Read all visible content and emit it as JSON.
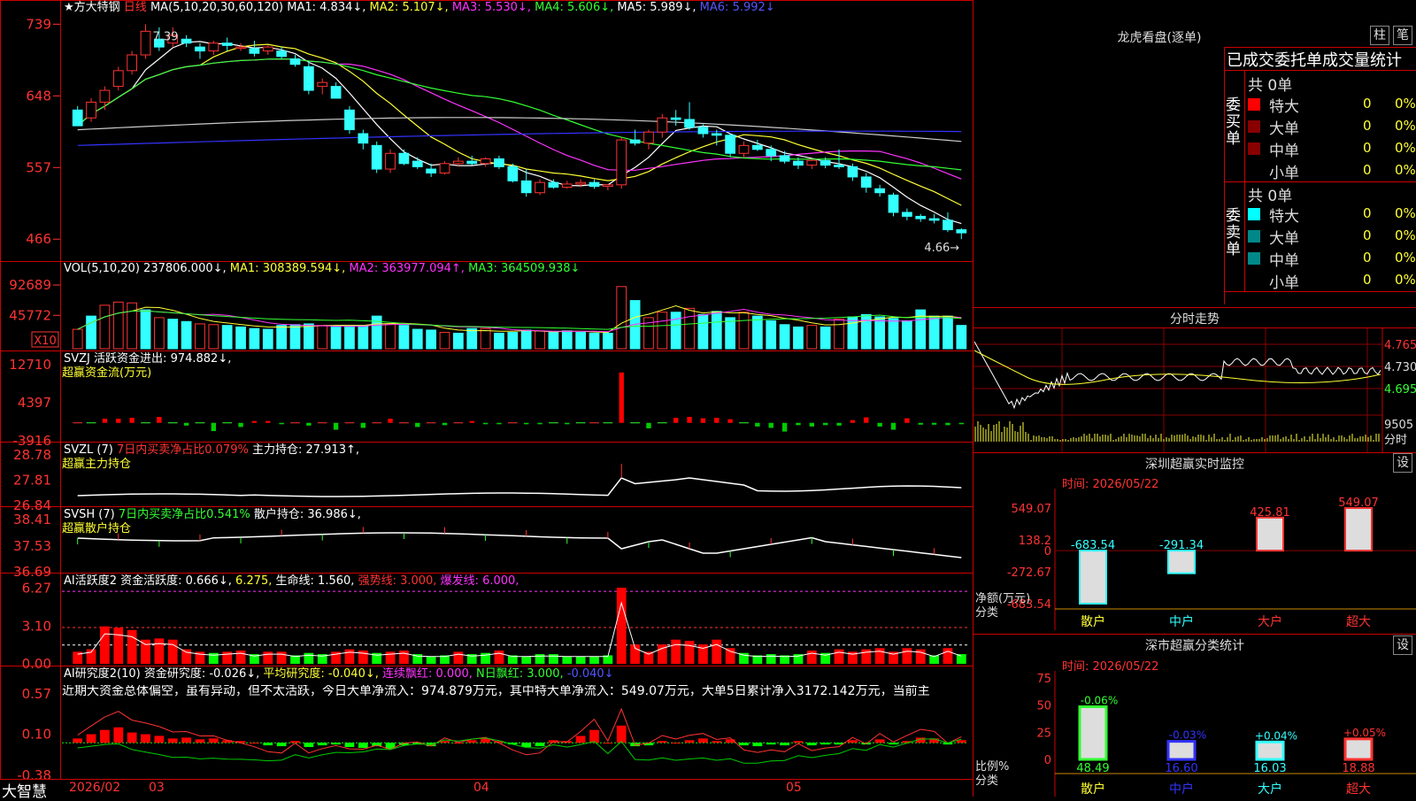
{
  "stock": {
    "title": "★方大特钢",
    "period": "日线"
  },
  "kline": {
    "header": {
      "ma_label": "MA(5,10,20,30,60,120)",
      "ma1": "MA1: 4.834↓,",
      "ma2": "MA2: 5.107↓,",
      "ma3": "MA3: 5.530↓,",
      "ma4": "MA4: 5.606↓,",
      "ma5": "MA5: 5.989↓,",
      "ma6": "MA6: 5.992↓"
    },
    "high_label": "7.39",
    "low_label": "4.66",
    "ylabels": [
      "739",
      "648",
      "557",
      "466"
    ],
    "ohlc": [
      [
        6.3,
        6.35,
        6.1,
        6.1
      ],
      [
        6.2,
        6.45,
        6.15,
        6.4
      ],
      [
        6.4,
        6.6,
        6.3,
        6.55
      ],
      [
        6.6,
        6.85,
        6.55,
        6.8
      ],
      [
        6.8,
        7.05,
        6.75,
        7.0
      ],
      [
        7.0,
        7.39,
        6.95,
        7.3
      ],
      [
        7.2,
        7.35,
        7.05,
        7.1
      ],
      [
        7.15,
        7.35,
        7.1,
        7.25
      ],
      [
        7.2,
        7.25,
        7.1,
        7.15
      ],
      [
        7.1,
        7.15,
        6.95,
        7.05
      ],
      [
        7.05,
        7.18,
        7.0,
        7.15
      ],
      [
        7.15,
        7.22,
        7.05,
        7.12
      ],
      [
        7.1,
        7.15,
        7.05,
        7.1
      ],
      [
        7.08,
        7.18,
        6.98,
        7.02
      ],
      [
        7.05,
        7.12,
        7.0,
        7.1
      ],
      [
        7.05,
        7.1,
        6.95,
        6.98
      ],
      [
        6.95,
        7.0,
        6.85,
        6.88
      ],
      [
        6.85,
        6.92,
        6.5,
        6.55
      ],
      [
        6.6,
        6.7,
        6.5,
        6.65
      ],
      [
        6.6,
        6.65,
        6.45,
        6.45
      ],
      [
        6.3,
        6.35,
        6.0,
        6.05
      ],
      [
        6.0,
        6.05,
        5.8,
        5.88
      ],
      [
        5.85,
        5.9,
        5.5,
        5.55
      ],
      [
        5.55,
        5.8,
        5.5,
        5.75
      ],
      [
        5.75,
        5.8,
        5.6,
        5.62
      ],
      [
        5.65,
        5.7,
        5.55,
        5.58
      ],
      [
        5.55,
        5.62,
        5.45,
        5.5
      ],
      [
        5.5,
        5.65,
        5.48,
        5.62
      ],
      [
        5.62,
        5.7,
        5.58,
        5.65
      ],
      [
        5.65,
        5.72,
        5.6,
        5.62
      ],
      [
        5.62,
        5.7,
        5.58,
        5.68
      ],
      [
        5.68,
        5.72,
        5.55,
        5.58
      ],
      [
        5.58,
        5.62,
        5.38,
        5.4
      ],
      [
        5.4,
        5.55,
        5.2,
        5.25
      ],
      [
        5.25,
        5.42,
        5.22,
        5.38
      ],
      [
        5.38,
        5.42,
        5.3,
        5.32
      ],
      [
        5.32,
        5.4,
        5.3,
        5.36
      ],
      [
        5.36,
        5.42,
        5.32,
        5.38
      ],
      [
        5.38,
        5.42,
        5.3,
        5.33
      ],
      [
        5.33,
        5.36,
        5.28,
        5.35
      ],
      [
        5.35,
        5.95,
        5.3,
        5.92
      ],
      [
        5.92,
        6.05,
        5.85,
        5.88
      ],
      [
        5.88,
        6.05,
        5.8,
        6.02
      ],
      [
        6.02,
        6.25,
        5.95,
        6.2
      ],
      [
        6.2,
        6.3,
        6.1,
        6.18
      ],
      [
        6.18,
        6.4,
        6.05,
        6.08
      ],
      [
        6.08,
        6.12,
        5.95,
        6.0
      ],
      [
        6.0,
        6.05,
        5.85,
        5.98
      ],
      [
        5.98,
        6.0,
        5.7,
        5.75
      ],
      [
        5.75,
        5.9,
        5.7,
        5.85
      ],
      [
        5.85,
        5.92,
        5.78,
        5.8
      ],
      [
        5.8,
        5.85,
        5.65,
        5.72
      ],
      [
        5.72,
        5.78,
        5.62,
        5.65
      ],
      [
        5.65,
        5.7,
        5.55,
        5.6
      ],
      [
        5.6,
        5.68,
        5.55,
        5.66
      ],
      [
        5.66,
        5.7,
        5.56,
        5.6
      ],
      [
        5.6,
        5.8,
        5.55,
        5.58
      ],
      [
        5.58,
        5.62,
        5.4,
        5.45
      ],
      [
        5.45,
        5.5,
        5.25,
        5.32
      ],
      [
        5.3,
        5.35,
        5.2,
        5.25
      ],
      [
        5.22,
        5.25,
        4.95,
        5.0
      ],
      [
        5.0,
        5.05,
        4.9,
        4.95
      ],
      [
        4.95,
        4.98,
        4.88,
        4.92
      ],
      [
        4.92,
        4.98,
        4.86,
        4.9
      ],
      [
        4.9,
        5.0,
        4.75,
        4.78
      ],
      [
        4.78,
        4.8,
        4.66,
        4.74
      ]
    ],
    "ma_colors": [
      "#fff",
      "#ff3",
      "#f3f",
      "#3f3",
      "#ccc",
      "#33f"
    ],
    "month_labels": [
      "2026/02",
      "03",
      "04",
      "05"
    ]
  },
  "vol": {
    "header": {
      "name": "VOL(5,10,20)",
      "v": "237806.000↓,",
      "ma1": "MA1: 308389.594↓,",
      "ma2": "MA2: 363977.094↑,",
      "ma3": "MA3: 364509.938↓"
    },
    "ylabels": [
      "92689",
      "45772",
      "X10"
    ],
    "values": [
      250,
      420,
      560,
      600,
      590,
      500,
      400,
      380,
      350,
      320,
      310,
      300,
      280,
      260,
      250,
      300,
      310,
      320,
      300,
      280,
      300,
      300,
      420,
      320,
      300,
      250,
      240,
      210,
      200,
      260,
      260,
      200,
      210,
      240,
      230,
      210,
      230,
      210,
      200,
      200,
      800,
      620,
      400,
      470,
      470,
      520,
      440,
      480,
      400,
      470,
      420,
      360,
      310,
      280,
      300,
      280,
      380,
      410,
      440,
      410,
      390,
      360,
      500,
      420,
      420,
      300,
      420,
      380,
      200
    ],
    "up": [
      true,
      false,
      true,
      true,
      true,
      false,
      true,
      false,
      false,
      true,
      true,
      false,
      false,
      false,
      false,
      false,
      false,
      false,
      true,
      false,
      false,
      false,
      false,
      true,
      false,
      false,
      false,
      true,
      false,
      false,
      true,
      false,
      false,
      false,
      true,
      false,
      false,
      false,
      false,
      false,
      true,
      false,
      true,
      true,
      false,
      true,
      false,
      false,
      false,
      true,
      false,
      false,
      false,
      false,
      true,
      false,
      true,
      false,
      false,
      false,
      false,
      false,
      false,
      false,
      false,
      false,
      false,
      false,
      false
    ]
  },
  "svzj": {
    "header": {
      "name": "SVZJ",
      "desc": "活跃资金进出:",
      "val": "974.882↓,",
      "sub": "超赢资金流(万元)"
    },
    "ylabels": [
      "12710",
      "4397",
      "-3916"
    ],
    "values": [
      0,
      0,
      900,
      900,
      1100,
      0,
      1300,
      0,
      -600,
      0,
      -1800,
      0,
      -900,
      400,
      400,
      -300,
      0,
      -600,
      0,
      -1500,
      0,
      -1100,
      0,
      900,
      0,
      -900,
      0,
      -500,
      0,
      400,
      -300,
      -300,
      0,
      -300,
      -300,
      0,
      -300,
      0,
      0,
      0,
      11000,
      0,
      -1200,
      0,
      1100,
      1300,
      1000,
      1100,
      800,
      0,
      -800,
      -1100,
      -1900,
      -500,
      -800,
      -500,
      -600,
      600,
      1200,
      -800,
      -1500,
      1000,
      -400,
      -400,
      -500,
      -300,
      1000,
      900,
      800
    ]
  },
  "svzl": {
    "header": {
      "name": "SVZL (7)",
      "desc": "7日内买卖净占比0.079%",
      "val": "主力持仓: 27.913↑,",
      "sub": "超赢主力持仓"
    },
    "ylabels": [
      "28.78",
      "27.81",
      "26.84"
    ]
  },
  "svsh": {
    "header": {
      "name": "SVSH (7)",
      "desc": "7日内买卖净占比0.541%",
      "val": "散户持仓: 36.986↓,",
      "sub": "超赢散户持仓"
    },
    "ylabels": [
      "38.41",
      "37.53",
      "36.69"
    ]
  },
  "ai": {
    "header": {
      "name": "AI活跃度2",
      "t1": "资金活跃度: 0.666↓,",
      "t2": "6.275,",
      "t3": "生命线: 1.560,",
      "t4": "强势线: 3.000,",
      "t5": "爆发线: 6.000,"
    },
    "ylabels": [
      "6.27",
      "3.10",
      "0.00"
    ],
    "values": [
      1.0,
      1.2,
      3.1,
      3.0,
      2.8,
      2.0,
      2.1,
      2.0,
      1.2,
      1.0,
      0.9,
      1.0,
      1.1,
      0.8,
      1.0,
      1.0,
      0.7,
      0.9,
      0.8,
      1.0,
      1.2,
      1.1,
      0.9,
      1.0,
      1.1,
      0.8,
      0.6,
      0.7,
      1.0,
      0.8,
      0.9,
      1.1,
      0.7,
      0.6,
      0.8,
      0.8,
      0.6,
      0.6,
      0.6,
      0.7,
      6.3,
      1.6,
      1.0,
      1.6,
      2.0,
      1.9,
      1.6,
      2.0,
      1.3,
      0.9,
      0.7,
      0.8,
      0.7,
      0.8,
      1.1,
      0.9,
      1.2,
      1.0,
      1.2,
      1.3,
      1.0,
      1.3,
      1.2,
      0.7,
      1.3,
      0.8,
      1.2,
      1.2,
      0.8
    ]
  },
  "research": {
    "header": {
      "name": "AI研究度2(10)",
      "t1": "资金研究度: -0.026↓,",
      "t2": "平均研究度: -0.040↓,",
      "t3": "连续飘红: 0.000,",
      "t4": "N日飘红: 3.000,",
      "t5": "-0.040↓"
    },
    "comment": "近期大资金总体偏空，虽有异动，但不太活跃，今日大单净流入：974.879万元，其中特大单净流入：549.07万元，大单5日累计净入3172.142万元，当前主",
    "ylabels": [
      "0.57",
      "0.10",
      "-0.38"
    ],
    "values": [
      0.05,
      0.1,
      0.15,
      0.18,
      0.12,
      0.1,
      0.08,
      0.05,
      0.06,
      0.04,
      0.05,
      0.03,
      0.02,
      0.0,
      -0.03,
      -0.04,
      0.02,
      -0.05,
      -0.03,
      -0.02,
      -0.05,
      -0.06,
      -0.04,
      -0.07,
      -0.03,
      -0.02,
      -0.04,
      0.02,
      0.0,
      0.03,
      0.05,
      0.02,
      -0.02,
      -0.05,
      -0.04,
      0.03,
      0.02,
      0.08,
      0.15,
      0.0,
      0.2,
      -0.04,
      -0.03,
      0.02,
      0.0,
      0.03,
      0.05,
      0.02,
      0.04,
      -0.03,
      -0.04,
      -0.02,
      -0.03,
      0.02,
      -0.03,
      -0.02,
      -0.02,
      0.03,
      -0.02,
      0.04,
      -0.02,
      0.02,
      0.06,
      0.05,
      -0.02,
      0.03,
      -0.03,
      0.02,
      -0.02
    ]
  },
  "footer": {
    "brand": "大智慧"
  },
  "dragon": {
    "title": "龙虎看盘(逐单)",
    "btn1": "柱",
    "btn2": "笔",
    "subtitle": "已成交委托单成交量统计",
    "buy_label": "委买单",
    "sell_label": "委卖单",
    "buy_total": "共 0单",
    "sell_total": "共 0单",
    "rows": [
      "特大",
      "大单",
      "中单",
      "小单"
    ],
    "count": "0",
    "pct": "0%",
    "buy_colors": [
      "#f00",
      "#800",
      "#800",
      ""
    ],
    "sell_colors": [
      "#0ff",
      "#088",
      "#088",
      ""
    ]
  },
  "minute": {
    "title": "分时走势",
    "ylabels": [
      "4.765",
      "4.730",
      "4.695",
      "9505",
      "分时"
    ]
  },
  "sz_monitor": {
    "title": "深圳超赢实时监控",
    "btn": "设",
    "time": "时间: 2026/05/22",
    "ylabels": [
      "549.07",
      "138.2",
      "0",
      "-272.67",
      "-683.54"
    ],
    "unit": "净额(万元)",
    "cat_label": "分类",
    "chart_data": {
      "type": "bar",
      "categories": [
        "散户",
        "中户",
        "大户",
        "超大"
      ],
      "values": [
        -683.54,
        -291.34,
        425.81,
        549.07
      ],
      "labels": [
        "-683.54",
        "-291.34",
        "425.81",
        "549.07"
      ],
      "ylim": [
        -683.54,
        549.07
      ]
    }
  },
  "sz_stats": {
    "title": "深市超赢分类统计",
    "btn": "设",
    "time": "时间: 2026/05/22",
    "ylabels": [
      "75",
      "50",
      "25",
      "0"
    ],
    "unit": "比例%",
    "cat_label": "分类",
    "chart_data": {
      "type": "bar",
      "categories": [
        "散户",
        "中户",
        "大户",
        "超大"
      ],
      "values": [
        48.49,
        16.6,
        16.03,
        18.88
      ],
      "changes": [
        "-0.06%",
        "-0.03%",
        "+0.04%",
        "+0.05%"
      ],
      "ylim": [
        0,
        75
      ],
      "colors": [
        "#3f3",
        "#33f",
        "#3ff",
        "#f33"
      ]
    }
  }
}
